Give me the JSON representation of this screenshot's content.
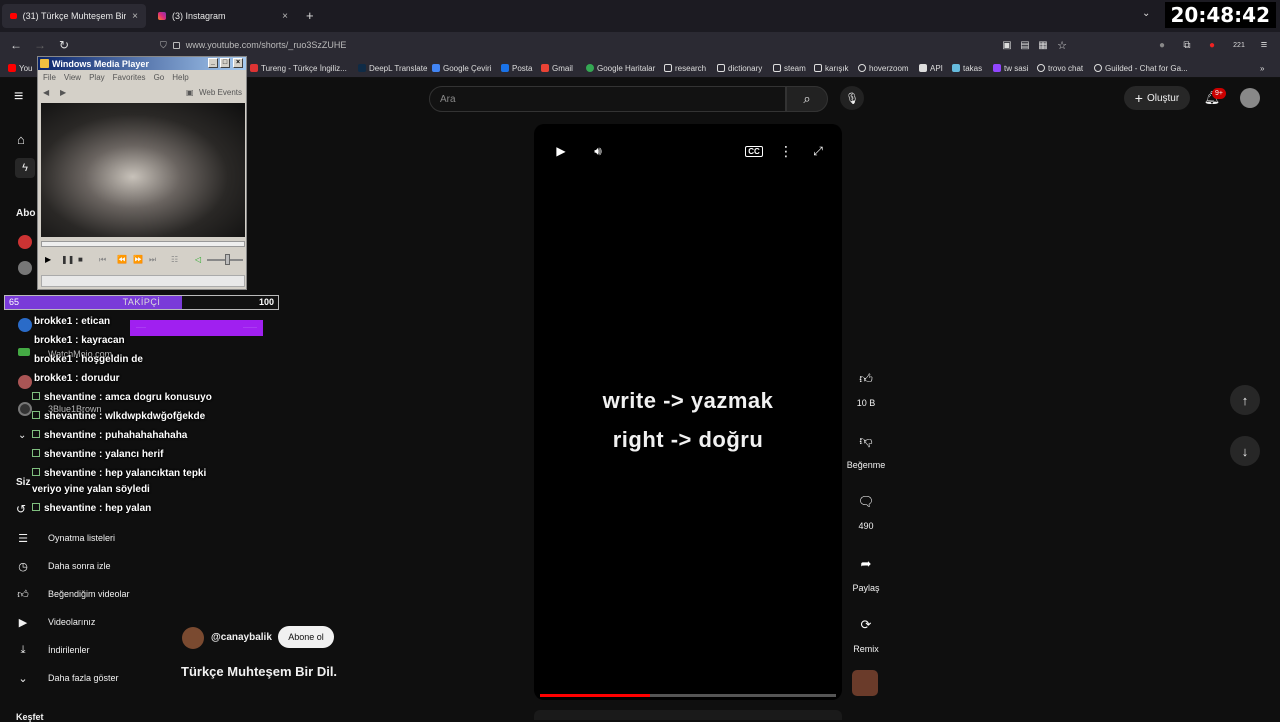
{
  "browser": {
    "tabs": [
      {
        "title": "(31) Türkçe Muhteşem Bir Dil. -",
        "close": "×",
        "active": true
      },
      {
        "title": "(3) Instagram",
        "close": "×",
        "active": false
      }
    ],
    "new_tab": "+",
    "url": "www.youtube.com/shorts/_ruo3SzZUHE",
    "clock": "20:48:42",
    "bookmarks": [
      "You",
      "Tureng - Türkçe İngiliz...",
      "DeepL Translate",
      "Google Çeviri",
      "Posta",
      "Gmail",
      "Google Haritalar",
      "research",
      "dictionary",
      "steam",
      "karışık",
      "hoverzoom",
      "API",
      "takas",
      "tw sasi",
      "trovo chat",
      "Guilded - Chat for Ga..."
    ],
    "ext_badge": "221"
  },
  "youtube": {
    "search_placeholder": "Ara",
    "create_label": "Oluştur",
    "notif_badge": "9+",
    "sidebar_fragments": {
      "subs": "Abo",
      "you": "Siz"
    },
    "sidebar_items": [
      {
        "label": "Oynatma listeleri",
        "icon": "playlist-icon"
      },
      {
        "label": "Daha sonra izle",
        "icon": "clock-icon"
      },
      {
        "label": "Beğendiğim videolar",
        "icon": "thumbs-up-icon"
      },
      {
        "label": "Videolarınız",
        "icon": "video-icon"
      },
      {
        "label": "İndirilenler",
        "icon": "download-icon"
      },
      {
        "label": "Daha fazla göster",
        "icon": "chevron-down-icon"
      }
    ],
    "sidebar_bottom": "Keşfet",
    "short": {
      "caption_line1": "write -> yazmak",
      "caption_line2": "right -> doğru",
      "progress": 0.37,
      "channel_handle": "@canaybalik",
      "subscribe_label": "Abone ol",
      "title": "Türkçe Muhteşem Bir Dil."
    },
    "actions": {
      "likes": "10 B",
      "dislike_label": "Beğenme",
      "comments": "490",
      "share_label": "Paylaş",
      "remix_label": "Remix"
    }
  },
  "overlay": {
    "wmp": {
      "title": "Windows Media Player",
      "menu": [
        "File",
        "View",
        "Play",
        "Favorites",
        "Go",
        "Help"
      ],
      "web_events": "Web Events"
    },
    "follower_bar": {
      "min": "65",
      "label": "TAKİPÇİ",
      "max": "100",
      "progress": 0.65
    },
    "chat": [
      "brokke1 : etican",
      "brokke1 : kayracan",
      "brokke1 : hoşgeldin de",
      "brokke1 : dorudur",
      "shevantine : amca dogru konusuyo",
      "shevantine : wlkdwpkdwğofğekde",
      "shevantine : puhahahahahaha",
      "shevantine : yalancı herif",
      "shevantine : hep yalancıktan tepki",
      "veriyo yine yalan söyledi",
      "shevantine : hep yalan"
    ],
    "ghost_channels": [
      "WatchMojo.com",
      "3Blue1Brown"
    ]
  }
}
